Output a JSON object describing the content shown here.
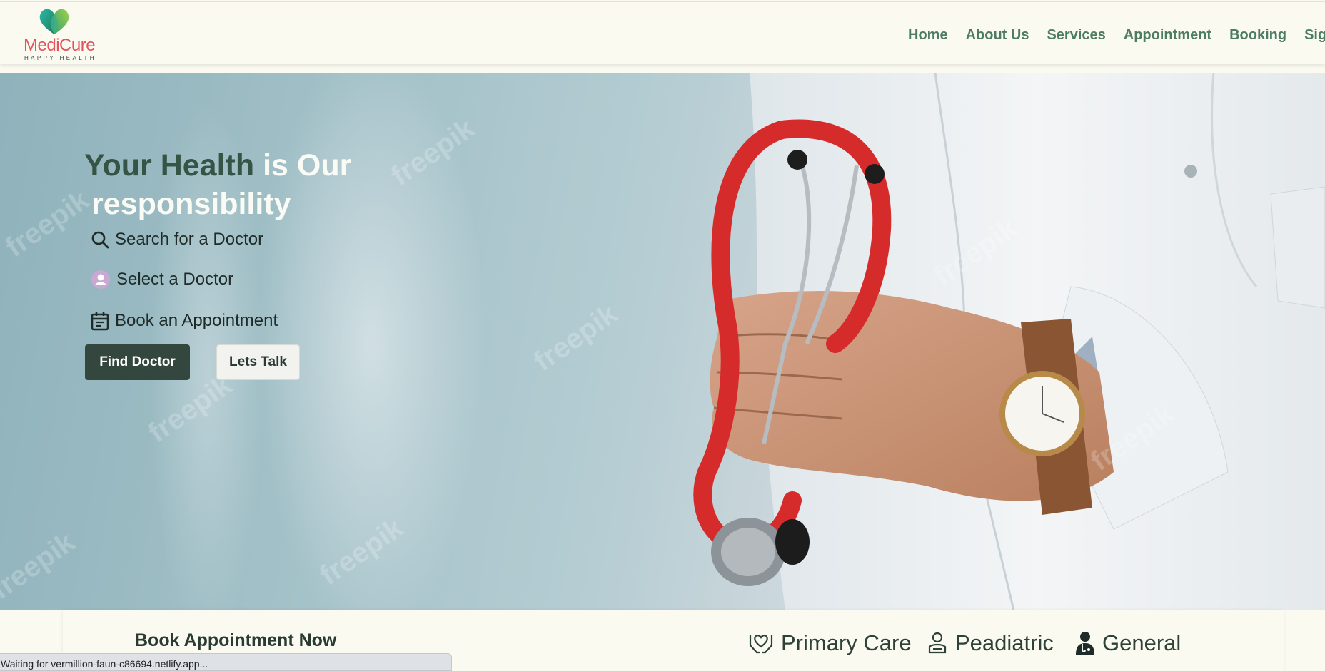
{
  "brand": {
    "name": "MediCure",
    "tagline": "HAPPY HEALTH"
  },
  "nav": {
    "items": [
      {
        "label": "Home"
      },
      {
        "label": "About Us"
      },
      {
        "label": "Services"
      },
      {
        "label": "Appointment"
      },
      {
        "label": "Booking"
      },
      {
        "label": "Sign"
      }
    ]
  },
  "hero": {
    "title_part1": "Your Health",
    "title_part2": " is Our",
    "title_part3": "responsibility",
    "features": [
      {
        "icon": "search-icon",
        "label": "Search for a Doctor"
      },
      {
        "icon": "user-avatar-icon",
        "label": "Select a Doctor"
      },
      {
        "icon": "calendar-icon",
        "label": "Book an Appointment"
      }
    ],
    "primary_button": "Find Doctor",
    "secondary_button": "Lets Talk",
    "watermark": "freepik"
  },
  "booking": {
    "title": "Book Appointment Now",
    "categories": [
      {
        "icon": "heart-hands-icon",
        "label": "Primary Care"
      },
      {
        "icon": "pediatric-care-icon",
        "label": "Peadiatric"
      },
      {
        "icon": "doctor-icon",
        "label": "General"
      }
    ]
  },
  "status_bar": {
    "text": "Waiting for vermillion-faun-c86694.netlify.app..."
  },
  "colors": {
    "brand_red": "#e2545d",
    "nav_green": "#4d7c63",
    "dark_green": "#34473f",
    "cream": "#fbfaf1"
  }
}
